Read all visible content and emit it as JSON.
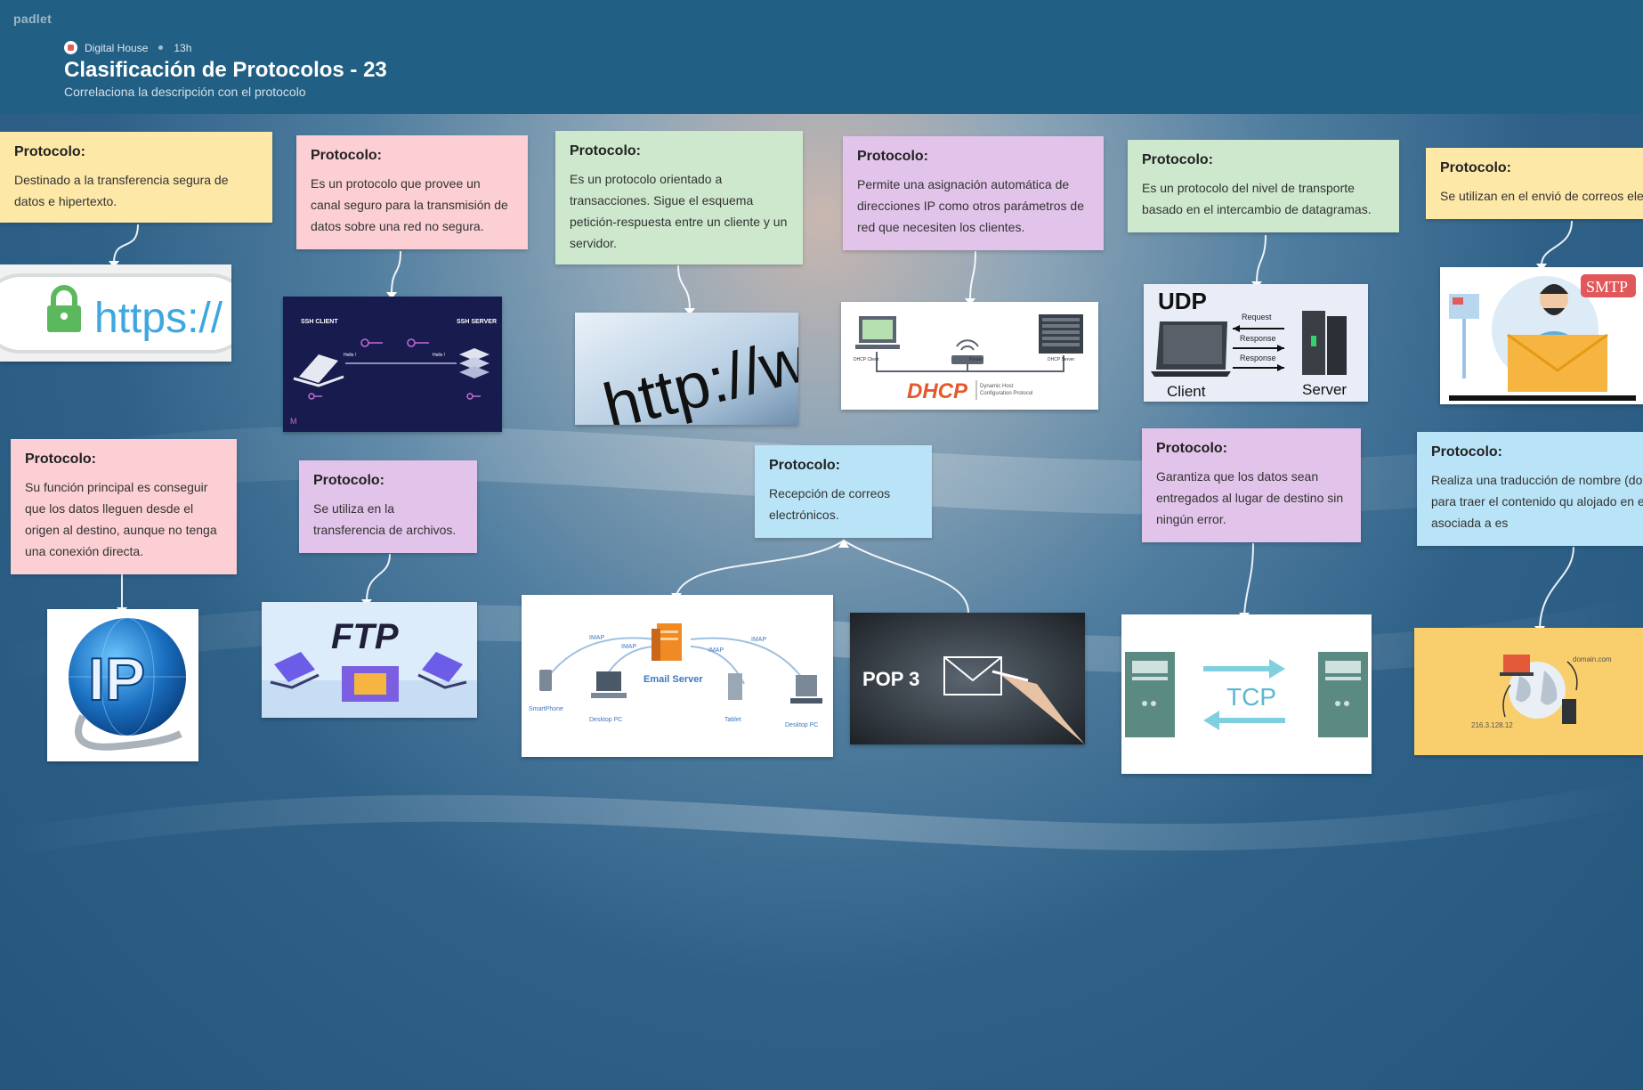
{
  "app": {
    "logo": "padlet"
  },
  "header": {
    "author": "Digital House",
    "time": "13h",
    "title": "Clasificación de Protocolos - 23",
    "subtitle": "Correlaciona la descripción con el protocolo"
  },
  "cards": {
    "heading": "Protocolo:",
    "c1": "Destinado a la transferencia segura de datos e hipertexto.",
    "c2": "Es un protocolo que provee un canal seguro para la transmisión de datos sobre una red no segura.",
    "c3": "Es un protocolo orientado a transacciones. Sigue el esquema petición-respuesta entre un cliente y un servidor.",
    "c4": "Permite una asignación automática de direcciones IP como otros parámetros de red que necesiten los clientes.",
    "c5": "Es un protocolo del nivel de transporte basado en el intercambio de datagramas.",
    "c6": "Se utilizan en el envió de correos elec",
    "c7": "Su función principal es conseguir que los datos lleguen desde el origen al destino, aunque no tenga una conexión directa.",
    "c8": "Se utiliza en la transferencia de archivos.",
    "c9": "Recepción de correos electrónicos.",
    "c10": "Garantiza que los datos sean entregados al lugar de destino sin ningún error.",
    "c11": "Realiza una traducción de nombre (dor número (IP) para traer el contenido qu alojado en esa dirección asociada a es"
  },
  "images": {
    "https": "https://",
    "ssh_client": "SSH CLIENT",
    "ssh_server": "SSH SERVER",
    "ssh_hello": "Hello !",
    "http": "http://ww",
    "dhcp": "DHCP",
    "dhcp_sub1": "Dynamic Host",
    "dhcp_sub2": "Configuration Protocol",
    "dhcp_client": "DHCP Client",
    "dhcp_router": "Router",
    "dhcp_server": "DHCP Server",
    "udp": "UDP",
    "udp_request": "Request",
    "udp_response": "Response",
    "udp_client": "Client",
    "udp_server": "Server",
    "smtp": "SMTP",
    "ip": "IP",
    "ftp": "FTP",
    "imap": "IMAP",
    "email_server": "Email Server",
    "smartphone": "SmartPhone",
    "desktop_pc": "Desktop PC",
    "tablet": "Tablet",
    "pop3": "POP 3",
    "tcp": "TCP",
    "domain": "domain.com",
    "ipaddr": "216.3.128.12"
  }
}
